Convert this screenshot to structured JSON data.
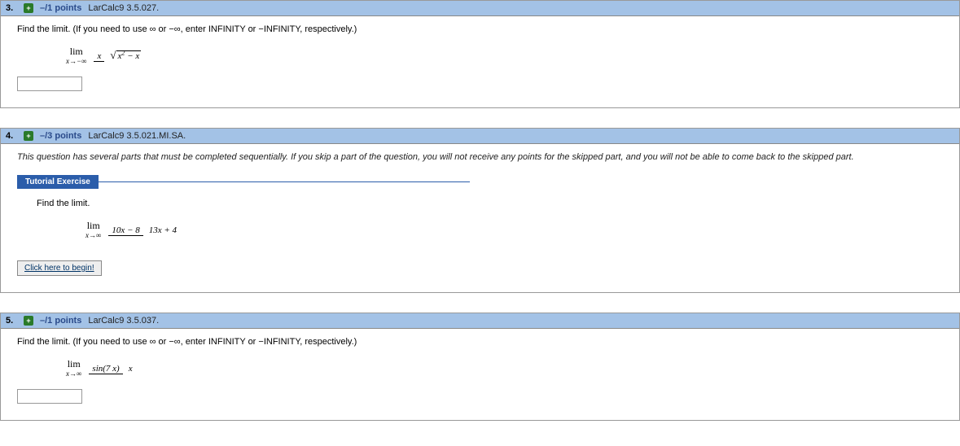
{
  "q3": {
    "num": "3.",
    "points": "–/1 points",
    "source": "LarCalc9 3.5.027.",
    "instruction": "Find the limit. (If you need to use ∞ or −∞, enter INFINITY or −INFINITY, respectively.)",
    "lim_label": "lim",
    "lim_sub": "x→−∞",
    "frac_top": "x",
    "sqrt_inner": "x",
    "sqrt_exp": "2",
    "sqrt_tail": " − x"
  },
  "q4": {
    "num": "4.",
    "points": "–/3 points",
    "source": "LarCalc9 3.5.021.MI.SA.",
    "note": "This question has several parts that must be completed sequentially. If you skip a part of the question, you will not receive any points for the skipped part, and you will not be able to come back to the skipped part.",
    "tutorial_label": "Tutorial Exercise",
    "instruction": "Find the limit.",
    "lim_label": "lim",
    "lim_sub": "x→∞",
    "frac_top": "10x − 8",
    "frac_bot": "13x + 4",
    "begin_label": "Click here to begin!"
  },
  "q5": {
    "num": "5.",
    "points": "–/1 points",
    "source": "LarCalc9 3.5.037.",
    "instruction": "Find the limit. (If you need to use ∞ or −∞, enter INFINITY or −INFINITY, respectively.)",
    "lim_label": "lim",
    "lim_sub": "x→∞",
    "frac_top": "sin(7 x)",
    "frac_bot": "x"
  }
}
